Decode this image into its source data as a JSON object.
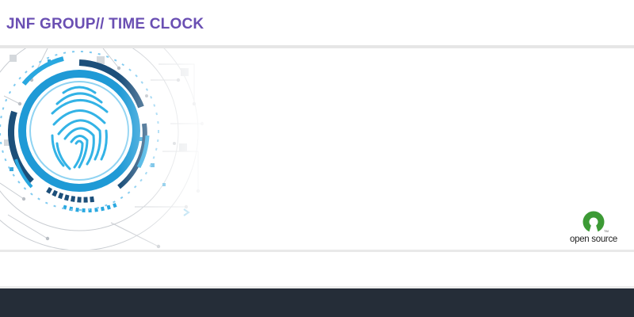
{
  "header": {
    "title": "JNF GROUP// TIME CLOCK"
  },
  "banner": {
    "image": "fingerprint-scan",
    "accent_color": "#29a8e0",
    "dark_blue": "#1c4f7a"
  },
  "badge": {
    "open_label": "open source"
  },
  "colors": {
    "title": "#6a4fb3",
    "footer": "#252d38",
    "open_source_green": "#3c9a35"
  }
}
